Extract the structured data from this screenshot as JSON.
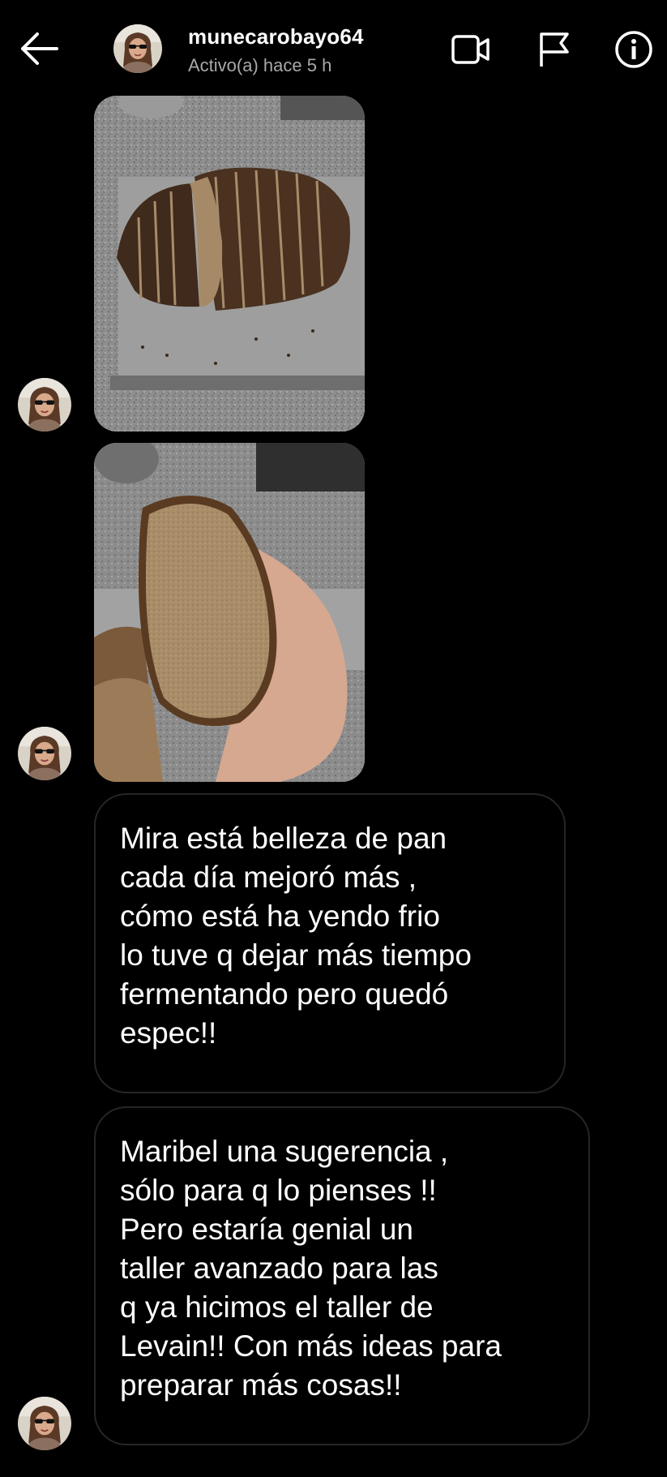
{
  "header": {
    "username": "munecarobayo64",
    "status": "Activo(a) hace 5 h",
    "icons": [
      "back-arrow-icon",
      "video-call-icon",
      "flag-icon",
      "info-icon"
    ]
  },
  "messages": [
    {
      "type": "image",
      "description_icon": "photo-bread-loaf-sliced"
    },
    {
      "type": "image",
      "description_icon": "photo-bread-slice-in-hand"
    },
    {
      "type": "text",
      "lines": [
        "Mira está belleza de pan",
        "cada día mejoró más ,",
        "cómo está ha yendo frio",
        "lo tuve q dejar más tiempo",
        "fermentando pero quedó",
        "espec!!"
      ]
    },
    {
      "type": "text",
      "lines": [
        "Maribel una sugerencia ,",
        "sólo para q lo pienses !!",
        "Pero estaría genial un",
        "taller avanzado para las",
        "q ya hicimos el taller de",
        "Levain!! Con más ideas para",
        "preparar más cosas!!"
      ]
    }
  ],
  "colors": {
    "background": "#000000",
    "text": "#ffffff",
    "secondary_text": "#a8a8a8",
    "bubble_border": "#262626"
  }
}
